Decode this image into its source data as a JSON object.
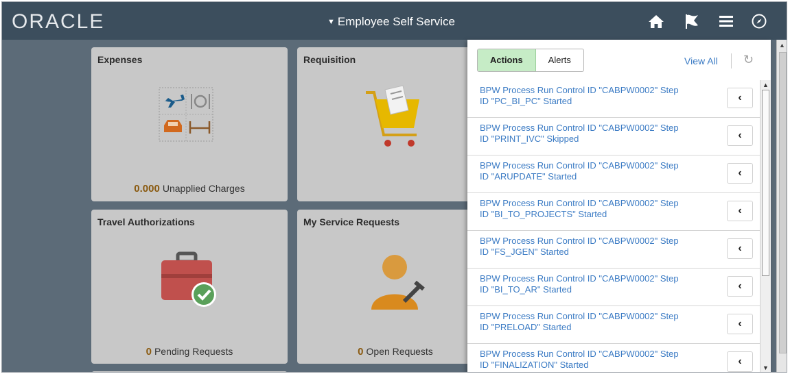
{
  "header": {
    "logo": "ORACLE",
    "title": "Employee Self Service",
    "icons": [
      "home-icon",
      "flag-icon",
      "menu-icon",
      "navigator-icon"
    ]
  },
  "tiles": {
    "expenses": {
      "title": "Expenses",
      "count": "0.000",
      "label": "Unapplied Charges"
    },
    "requisition": {
      "title": "Requisition"
    },
    "travel": {
      "title": "Travel Authorizations",
      "count": "0",
      "label": "Pending Requests"
    },
    "service": {
      "title": "My Service Requests",
      "count": "0",
      "label": "Open Requests"
    }
  },
  "panel": {
    "tabs": {
      "actions": "Actions",
      "alerts": "Alerts"
    },
    "view_all": "View All",
    "chevron": "‹",
    "items": [
      {
        "line1": "BPW Process Run Control ID \"CABPW0002\" Step",
        "line2": "ID \"PC_BI_PC\" Started"
      },
      {
        "line1": "BPW Process Run Control ID \"CABPW0002\" Step",
        "line2": "ID \"PRINT_IVC\" Skipped"
      },
      {
        "line1": "BPW Process Run Control ID \"CABPW0002\" Step",
        "line2": "ID \"ARUPDATE\" Started"
      },
      {
        "line1": "BPW Process Run Control ID \"CABPW0002\" Step",
        "line2": "ID \"BI_TO_PROJECTS\" Started"
      },
      {
        "line1": "BPW Process Run Control ID \"CABPW0002\" Step",
        "line2": "ID \"FS_JGEN\" Started"
      },
      {
        "line1": "BPW Process Run Control ID \"CABPW0002\" Step",
        "line2": "ID \"BI_TO_AR\" Started"
      },
      {
        "line1": "BPW Process Run Control ID \"CABPW0002\" Step",
        "line2": "ID \"PRELOAD\" Started"
      },
      {
        "line1": "BPW Process Run Control ID \"CABPW0002\" Step",
        "line2": "ID \"FINALIZATION\" Started"
      }
    ]
  },
  "colors": {
    "header": "#3c4e5d",
    "background": "#5c6b78",
    "link": "#3b7bc4",
    "active_tab": "#c6ecc6"
  }
}
